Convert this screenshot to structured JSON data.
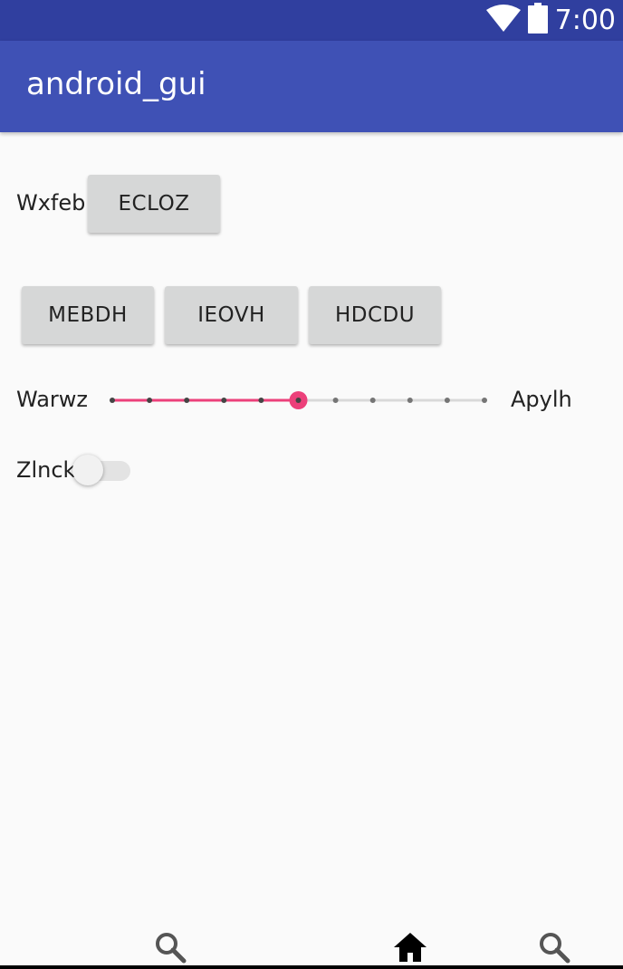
{
  "status_bar": {
    "time": "7:00",
    "icons": [
      "wifi-icon",
      "battery-icon"
    ]
  },
  "app_bar": {
    "title": "android_gui"
  },
  "row1": {
    "label": "Wxfeb",
    "button": "ECLOZ"
  },
  "row2": {
    "buttons": [
      "MEBDH",
      "IEOVH",
      "HDCDU"
    ]
  },
  "slider": {
    "min_label": "Warwz",
    "max_label": "Apylh",
    "step_count": 10,
    "value": 5,
    "accent": "#ec407a"
  },
  "switch": {
    "label": "Zlnck",
    "checked": false
  },
  "nav": {
    "icons": [
      "search-icon",
      "home-icon",
      "search-icon"
    ]
  },
  "colors": {
    "status_bar": "#303f9f",
    "app_bar": "#3f51b5",
    "background": "#fafafa",
    "button": "#d6d7d7"
  }
}
